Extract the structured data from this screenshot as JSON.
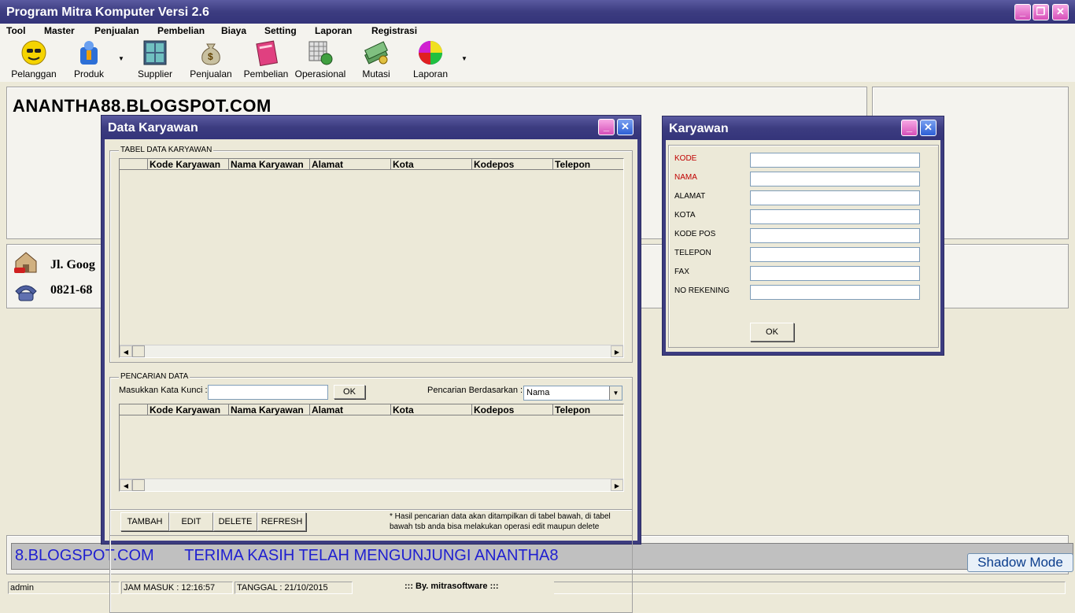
{
  "app": {
    "title": "Program Mitra Komputer Versi 2.6"
  },
  "menu": [
    {
      "label": "Tool"
    },
    {
      "label": "Master"
    },
    {
      "label": "Penjualan"
    },
    {
      "label": "Pembelian"
    },
    {
      "label": "Biaya"
    },
    {
      "label": "Setting"
    },
    {
      "label": "Laporan"
    },
    {
      "label": "Registrasi"
    }
  ],
  "toolbar": {
    "pelanggan": "Pelanggan",
    "produk": "Produk",
    "supplier": "Supplier",
    "penjualan": "Penjualan",
    "pembelian": "Pembelian",
    "operasional": "Operasional",
    "mutasi": "Mutasi",
    "laporan": "Laporan"
  },
  "brand": {
    "title": "ANANTHA88.BLOGSPOT.COM",
    "address": "Jl. Goog",
    "phone": "0821-68"
  },
  "marquee": "8.BLOGSPOT.COM       TERIMA KASIH TELAH MENGUNJUNGI ANANTHA8",
  "shadow_mode": "Shadow Mode",
  "status": {
    "user": "admin",
    "jam_masuk": "JAM MASUK : 12:16:57",
    "tanggal": "TANGGAL : 21/10/2015",
    "by": "::: By. mitrasoftware :::"
  },
  "data_karyawan": {
    "title": "Data Karyawan",
    "table_group": "TABEL DATA KARYAWAN",
    "columns": [
      "",
      "Kode Karyawan",
      "Nama Karyawan",
      "Alamat",
      "Kota",
      "Kodepos",
      "Telepon"
    ],
    "search_group": "PENCARIAN DATA",
    "keyword_label": "Masukkan Kata Kunci :",
    "keyword_value": "",
    "ok_label": "OK",
    "search_by_label": "Pencarian Berdasarkan :",
    "search_by_value": "Nama",
    "buttons": {
      "tambah": "TAMBAH",
      "edit": "EDIT",
      "delete": "DELETE",
      "refresh": "REFRESH"
    },
    "note_line1": "* Hasil pencarian data akan ditampilkan di tabel bawah, di tabel",
    "note_line2": "bawah tsb anda bisa melakukan operasi edit maupun delete"
  },
  "karyawan_form": {
    "title": "Karyawan",
    "fields": [
      {
        "label": "KODE",
        "value": ""
      },
      {
        "label": "NAMA",
        "value": ""
      },
      {
        "label": "ALAMAT",
        "value": ""
      },
      {
        "label": "KOTA",
        "value": ""
      },
      {
        "label": "KODE POS",
        "value": ""
      },
      {
        "label": "TELEPON",
        "value": ""
      },
      {
        "label": "FAX",
        "value": ""
      },
      {
        "label": "NO REKENING",
        "value": ""
      }
    ],
    "ok_label": "OK"
  },
  "colors": {
    "title_bar": "#3c3c80",
    "required_label": "#c00000",
    "marquee_text": "#2020d0"
  }
}
